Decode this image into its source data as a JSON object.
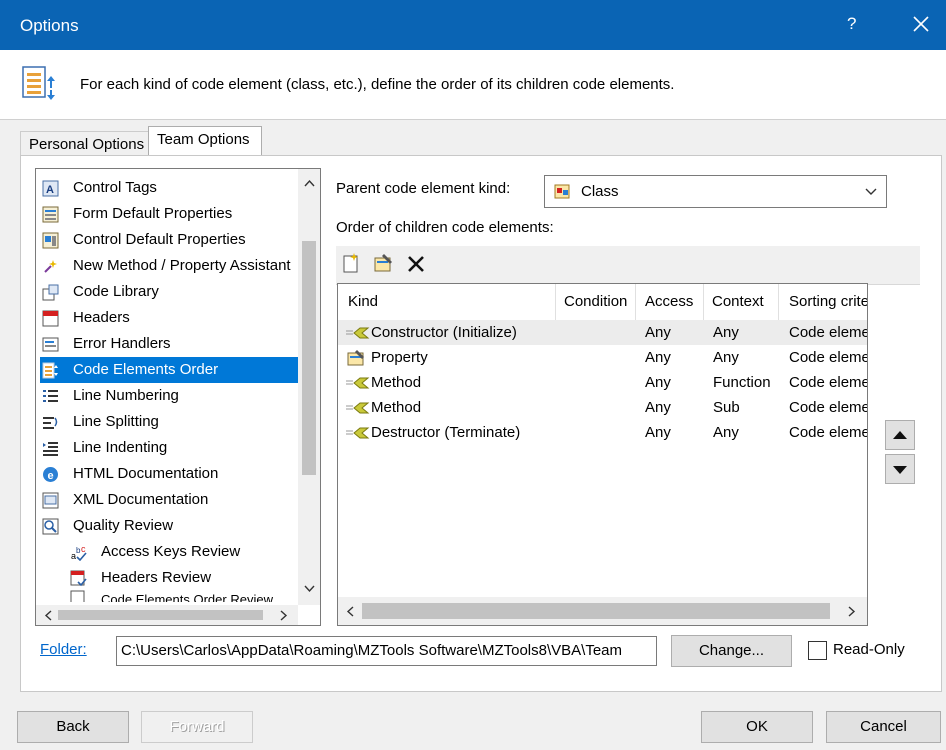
{
  "window": {
    "title": "Options",
    "help": "?"
  },
  "header": {
    "description": "For each kind of code element (class, etc.), define the order of its children code elements."
  },
  "tabs": [
    {
      "label": "Personal Options"
    },
    {
      "label": "Team Options"
    }
  ],
  "tree": {
    "items": [
      {
        "label": "Control Tags",
        "icon": "control-tags-icon"
      },
      {
        "label": "Form Default Properties",
        "icon": "form-properties-icon"
      },
      {
        "label": "Control Default Properties",
        "icon": "control-properties-icon"
      },
      {
        "label": "New Method / Property Assistant",
        "icon": "assistant-icon"
      },
      {
        "label": "Code Library",
        "icon": "code-library-icon"
      },
      {
        "label": "Headers",
        "icon": "headers-icon"
      },
      {
        "label": "Error Handlers",
        "icon": "error-handlers-icon"
      },
      {
        "label": "Code Elements Order",
        "icon": "code-order-icon",
        "selected": true
      },
      {
        "label": "Line Numbering",
        "icon": "line-numbering-icon"
      },
      {
        "label": "Line Splitting",
        "icon": "line-splitting-icon"
      },
      {
        "label": "Line Indenting",
        "icon": "line-indenting-icon"
      },
      {
        "label": "HTML Documentation",
        "icon": "html-doc-icon"
      },
      {
        "label": "XML Documentation",
        "icon": "xml-doc-icon"
      },
      {
        "label": "Quality Review",
        "icon": "quality-review-icon"
      },
      {
        "label": "Access Keys Review",
        "icon": "access-keys-icon"
      },
      {
        "label": "Headers Review",
        "icon": "headers-review-icon"
      },
      {
        "label": "Code Elements Order Review",
        "icon": "order-review-icon"
      }
    ]
  },
  "parent_kind": {
    "label": "Parent code element kind:",
    "value": "Class"
  },
  "children_label": "Order of children code elements:",
  "grid": {
    "columns": [
      "Kind",
      "Condition",
      "Access",
      "Context",
      "Sorting crite"
    ],
    "rows": [
      {
        "kind": "Constructor (Initialize)",
        "condition": "",
        "access": "Any",
        "context": "Any",
        "sorting": "Code eleme",
        "icon": "method-icon"
      },
      {
        "kind": "Property",
        "condition": "",
        "access": "Any",
        "context": "Any",
        "sorting": "Code eleme",
        "icon": "property-icon"
      },
      {
        "kind": "Method",
        "condition": "",
        "access": "Any",
        "context": "Function",
        "sorting": "Code eleme",
        "icon": "method-icon"
      },
      {
        "kind": "Method",
        "condition": "",
        "access": "Any",
        "context": "Sub",
        "sorting": "Code eleme",
        "icon": "method-icon"
      },
      {
        "kind": "Destructor (Terminate)",
        "condition": "",
        "access": "Any",
        "context": "Any",
        "sorting": "Code eleme",
        "icon": "method-icon"
      }
    ]
  },
  "folder": {
    "link": "Folder:",
    "path": "C:\\Users\\Carlos\\AppData\\Roaming\\MZTools Software\\MZTools8\\VBA\\Team",
    "change_label": "Change...",
    "readonly_label": "Read-Only",
    "readonly_checked": false
  },
  "footer": {
    "back": "Back",
    "forward": "Forward",
    "ok": "OK",
    "cancel": "Cancel"
  },
  "colors": {
    "titlebar": "#0a64b4",
    "selection": "#0078d7",
    "link": "#0066cc"
  }
}
